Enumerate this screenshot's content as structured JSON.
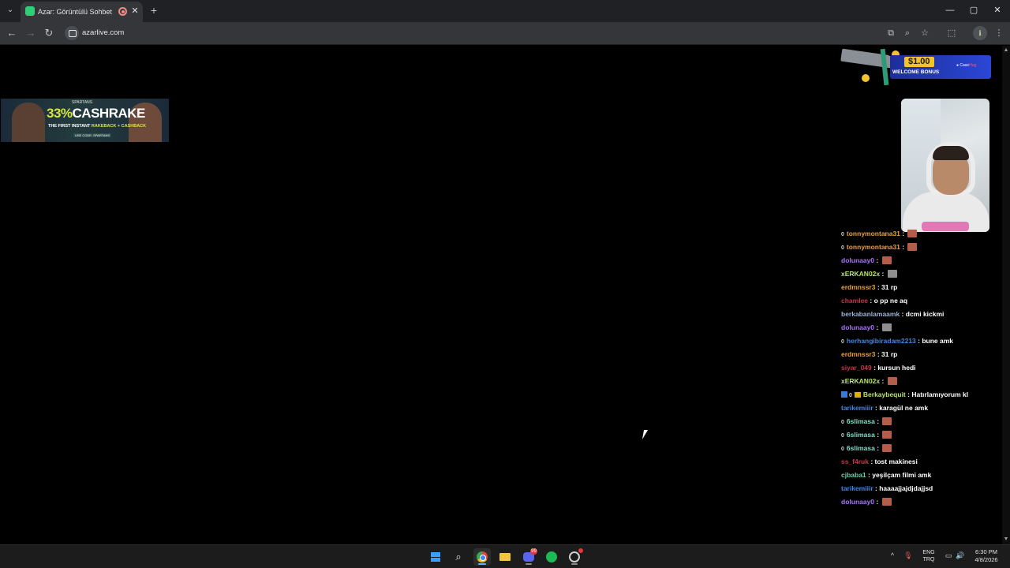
{
  "browser": {
    "tab": {
      "title": "Azar: Görüntülü Sohbet & Y",
      "close_glyph": "✕"
    },
    "tab_list_glyph": "⌄",
    "new_tab_glyph": "+",
    "window_controls": {
      "minimize": "—",
      "maximize": "▢",
      "close": "✕"
    },
    "nav": {
      "back": "←",
      "forward": "→",
      "reload": "↻"
    },
    "url": "azarlive.com",
    "toolbar_icons": {
      "cast": "⧉",
      "zoom": "⌕",
      "bookmark": "☆",
      "extensions": "⬚",
      "menu": "⋮"
    },
    "profile_initial": "ℹ"
  },
  "ads": {
    "left": {
      "brand": "SPARTANS",
      "headline_accent": "33%",
      "headline_rest": "CASHRAKE",
      "sub_prefix": "THE FIRST INSTANT ",
      "sub_accent": "RAKEBACK + CASHBACK",
      "code": "USE CODE: SPARTANS"
    },
    "right": {
      "amount": "$1.00",
      "welcome": "WELCOME BONUS",
      "brand_prefix": "● Case",
      "brand_suffix": "Hug"
    }
  },
  "chat": [
    {
      "badge": "0",
      "user": "tonnymontana31",
      "user_color": "#e8a23a",
      "text": "",
      "emote": "red"
    },
    {
      "badge": "0",
      "user": "tonnymontana31",
      "user_color": "#e8a23a",
      "text": "",
      "emote": "red"
    },
    {
      "badge": "",
      "user": "dolunaay0",
      "user_color": "#a974ff",
      "text": "",
      "emote": "red"
    },
    {
      "badge": "",
      "user": "xERKAN02x",
      "user_color": "#b9e26b",
      "text": "",
      "emote": "gray"
    },
    {
      "badge": "",
      "user": "erdmnssr3",
      "user_color": "#e8a23a",
      "text": "31 rp",
      "emote": ""
    },
    {
      "badge": "",
      "user": "chamlee",
      "user_color": "#c8344a",
      "text": "o pp ne aq",
      "emote": ""
    },
    {
      "badge": "",
      "user": "berkabanlamaamk",
      "user_color": "#9ab4d6",
      "text": "dcmi kickmi",
      "emote": ""
    },
    {
      "badge": "",
      "user": "dolunaay0",
      "user_color": "#a974ff",
      "text": "",
      "emote": "gray"
    },
    {
      "badge": "0",
      "user": "herhangibiradam2213",
      "user_color": "#3f86e6",
      "text": "bune amk",
      "emote": ""
    },
    {
      "badge": "",
      "user": "erdmnssr3",
      "user_color": "#e8a23a",
      "text": "31 rp",
      "emote": ""
    },
    {
      "badge": "",
      "user": "siyar_049",
      "user_color": "#c8344a",
      "text": "kursun hedi",
      "emote": ""
    },
    {
      "badge": "",
      "user": "xERKAN02x",
      "user_color": "#b9e26b",
      "text": "",
      "emote": "red"
    },
    {
      "badge": "0",
      "user": "Berkaybequit",
      "user_color": "#b9e26b",
      "text": "Hatırlamıyorum kl",
      "emote": "",
      "extra_badges": true
    },
    {
      "badge": "",
      "user": "tarikemiiir",
      "user_color": "#3f86e6",
      "text": "karagül ne amk",
      "emote": ""
    },
    {
      "badge": "0",
      "user": "6slimasa",
      "user_color": "#7fe0c8",
      "text": "",
      "emote": "red"
    },
    {
      "badge": "0",
      "user": "6slimasa",
      "user_color": "#7fe0c8",
      "text": "",
      "emote": "red"
    },
    {
      "badge": "0",
      "user": "6slimasa",
      "user_color": "#7fe0c8",
      "text": "",
      "emote": "red"
    },
    {
      "badge": "",
      "user": "ss_f4ruk",
      "user_color": "#c8344a",
      "text": "tost makinesi",
      "emote": ""
    },
    {
      "badge": "",
      "user": "cjbaba1",
      "user_color": "#5fd6a8",
      "text": "yeşilçam filmi amk",
      "emote": ""
    },
    {
      "badge": "",
      "user": "tarikemiiir",
      "user_color": "#3f86e6",
      "text": "haaaajjajdjdajjsd",
      "emote": ""
    },
    {
      "badge": "",
      "user": "dolunaay0",
      "user_color": "#a974ff",
      "text": "",
      "emote": "red"
    }
  ],
  "taskbar": {
    "search_glyph": "⌕",
    "discord_badge": "99",
    "tray": {
      "chevron": "^",
      "mic": "🎙",
      "lang_top": "ENG",
      "lang_bottom": "TRQ",
      "net": "▭",
      "volume": "🔊"
    },
    "time": "6:30 PM",
    "date": "4/8/2026"
  }
}
